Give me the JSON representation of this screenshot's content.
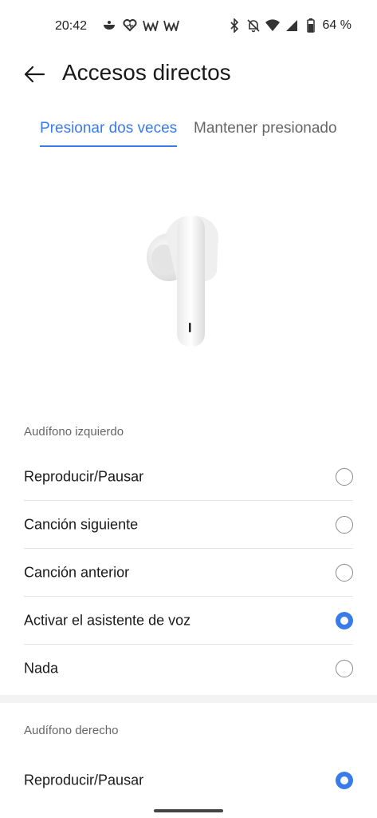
{
  "status_bar": {
    "time": "20:42",
    "left_icons": [
      "bowl-icon",
      "heart-monitor-icon",
      "wwe-icon",
      "wwe-icon"
    ],
    "right_icons": [
      "bluetooth-icon",
      "bell-off-icon",
      "wifi-icon",
      "cellular-signal-icon",
      "battery-icon"
    ],
    "battery_percent": "64 %"
  },
  "header": {
    "title": "Accesos directos",
    "back_icon": "arrow-left-icon"
  },
  "tabs": [
    {
      "label": "Presionar dos veces",
      "active": true
    },
    {
      "label": "Mantener presionado",
      "active": false
    }
  ],
  "sections": {
    "left": {
      "title": "Audífono izquierdo",
      "options": [
        {
          "label": "Reproducir/Pausar",
          "selected": false
        },
        {
          "label": "Canción siguiente",
          "selected": false
        },
        {
          "label": "Canción anterior",
          "selected": false
        },
        {
          "label": "Activar el asistente de voz",
          "selected": true
        },
        {
          "label": "Nada",
          "selected": false
        }
      ]
    },
    "right": {
      "title": "Audífono derecho",
      "options": [
        {
          "label": "Reproducir/Pausar",
          "selected": true
        }
      ]
    }
  },
  "colors": {
    "accent": "#3a7bec",
    "text": "#1a1a1a",
    "muted": "#666666",
    "divider": "#e4e4e4"
  }
}
